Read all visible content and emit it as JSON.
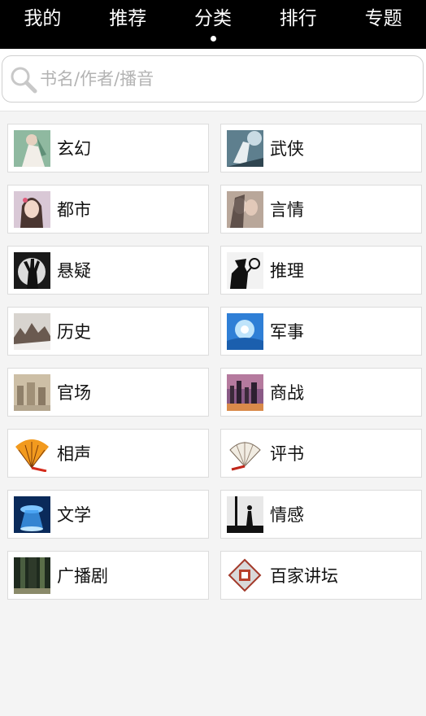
{
  "nav": {
    "tabs": [
      {
        "label": "我的"
      },
      {
        "label": "推荐"
      },
      {
        "label": "分类",
        "active": true
      },
      {
        "label": "排行"
      },
      {
        "label": "专题"
      }
    ]
  },
  "search": {
    "placeholder": "书名/作者/播音",
    "value": ""
  },
  "categories": [
    {
      "label": "玄幻",
      "icon": "fantasy-thumb"
    },
    {
      "label": "武侠",
      "icon": "martial-arts-thumb"
    },
    {
      "label": "都市",
      "icon": "urban-thumb"
    },
    {
      "label": "言情",
      "icon": "romance-thumb"
    },
    {
      "label": "悬疑",
      "icon": "suspense-thumb"
    },
    {
      "label": "推理",
      "icon": "detective-thumb"
    },
    {
      "label": "历史",
      "icon": "history-thumb"
    },
    {
      "label": "军事",
      "icon": "military-thumb"
    },
    {
      "label": "官场",
      "icon": "officialdom-thumb"
    },
    {
      "label": "商战",
      "icon": "business-thumb"
    },
    {
      "label": "相声",
      "icon": "crosstalk-thumb"
    },
    {
      "label": "评书",
      "icon": "storytelling-thumb"
    },
    {
      "label": "文学",
      "icon": "literature-thumb"
    },
    {
      "label": "情感",
      "icon": "emotion-thumb"
    },
    {
      "label": "广播剧",
      "icon": "radio-drama-thumb"
    },
    {
      "label": "百家讲坛",
      "icon": "lecture-room-thumb"
    }
  ]
}
